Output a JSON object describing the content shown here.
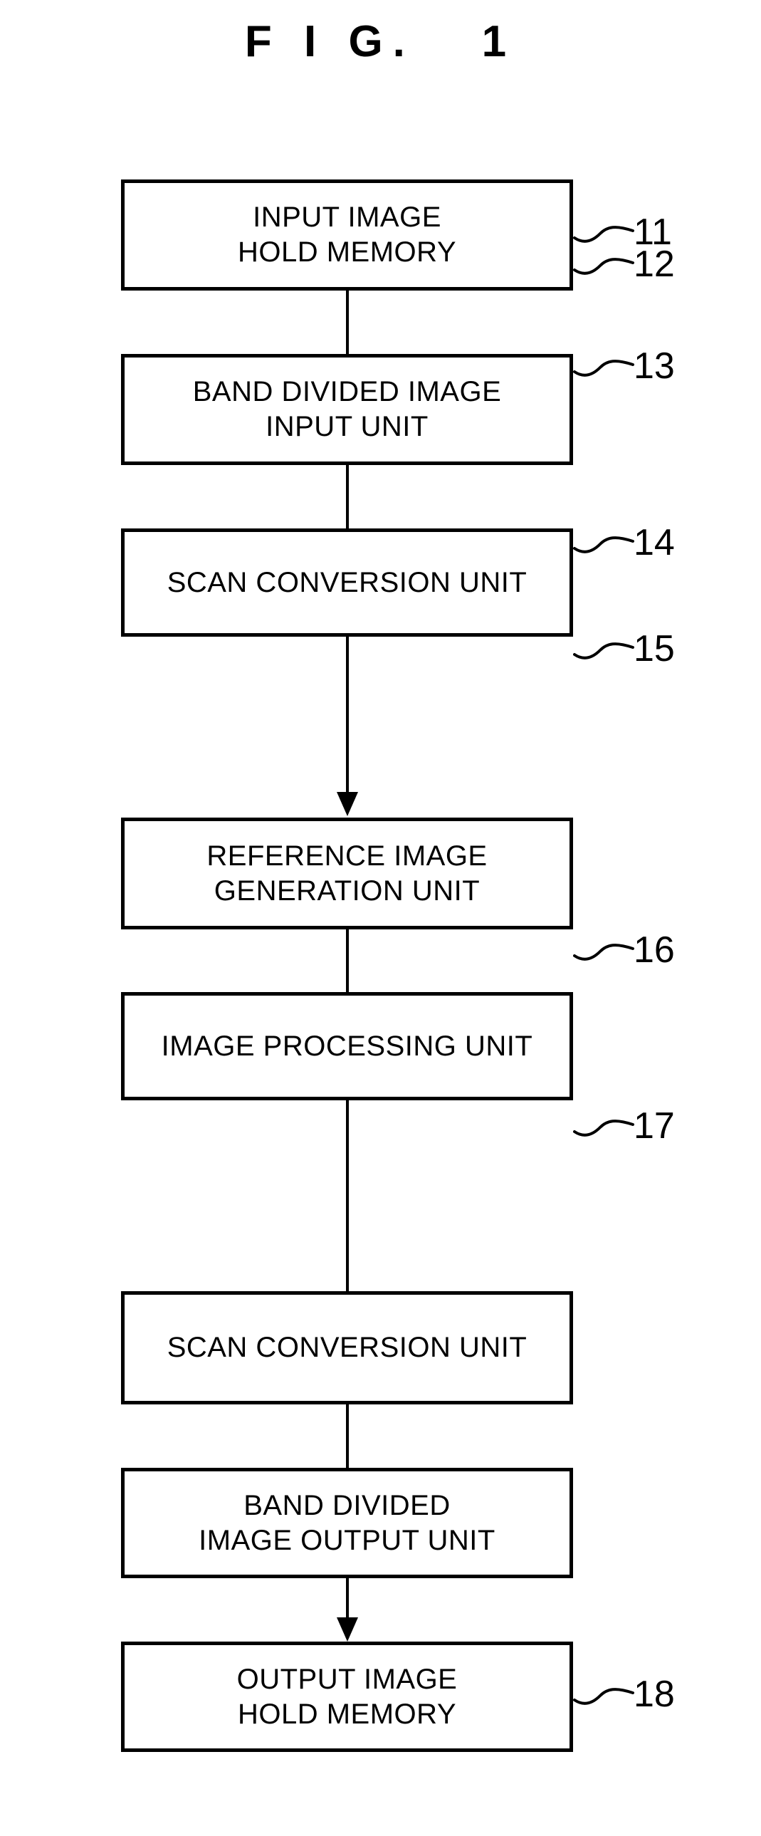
{
  "figure": {
    "title": "F I G.   1",
    "title_plain": "FIG. 1",
    "background_color": "#ffffff",
    "line_color": "#000000"
  },
  "blocks": [
    {
      "ref": "11",
      "label": "INPUT IMAGE\nHOLD MEMORY",
      "line1": "INPUT IMAGE",
      "line2": "HOLD MEMORY"
    },
    {
      "ref": "12",
      "label": "BAND DIVIDED IMAGE\nINPUT UNIT",
      "line1": "BAND DIVIDED IMAGE",
      "line2": "INPUT UNIT"
    },
    {
      "ref": "13",
      "label": "SCAN CONVERSION UNIT",
      "line1": "SCAN CONVERSION UNIT",
      "line2": ""
    },
    {
      "ref": "14",
      "label": "REFERENCE IMAGE\nGENERATION UNIT",
      "line1": "REFERENCE IMAGE",
      "line2": "GENERATION UNIT"
    },
    {
      "ref": "15",
      "label": "IMAGE PROCESSING UNIT",
      "line1": "IMAGE PROCESSING UNIT",
      "line2": ""
    },
    {
      "ref": "16",
      "label": "SCAN CONVERSION UNIT",
      "line1": "SCAN CONVERSION UNIT",
      "line2": ""
    },
    {
      "ref": "17",
      "label": "BAND DIVIDED\nIMAGE OUTPUT UNIT",
      "line1": "BAND DIVIDED",
      "line2": "IMAGE OUTPUT UNIT"
    },
    {
      "ref": "18",
      "label": "OUTPUT IMAGE\nHOLD MEMORY",
      "line1": "OUTPUT IMAGE",
      "line2": "HOLD MEMORY"
    }
  ],
  "connectors": [
    {
      "from": "11",
      "to": "12",
      "arrowhead": false
    },
    {
      "from": "12",
      "to": "13",
      "arrowhead": false
    },
    {
      "from": "13",
      "to": "14",
      "arrowhead": true
    },
    {
      "from": "14",
      "to": "15",
      "arrowhead": false
    },
    {
      "from": "15",
      "to": "16",
      "arrowhead": false
    },
    {
      "from": "16",
      "to": "17",
      "arrowhead": false
    },
    {
      "from": "17",
      "to": "18",
      "arrowhead": true
    }
  ]
}
